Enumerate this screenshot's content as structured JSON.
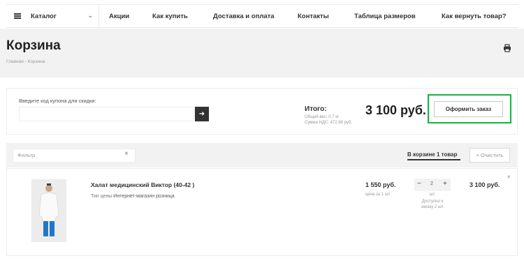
{
  "nav": {
    "catalog_label": "Каталог",
    "items": [
      "Акции",
      "Как купить",
      "Доставка и оплата",
      "Контакты",
      "Таблица размеров",
      "Как вернуть товар?"
    ]
  },
  "header": {
    "title": "Корзина",
    "breadcrumb": "Главная - Корзина"
  },
  "summary": {
    "coupon_label": "Введите код купона для скидки:",
    "coupon_value": "",
    "total_label": "Итого:",
    "weight": "Общий вес: 0.7 кг",
    "vat": "Сумма НДС: 472.88 руб.",
    "total_price": "3 100 руб.",
    "checkout_label": "Оформить заказ"
  },
  "filter": {
    "placeholder": "Фильтр",
    "basket_tab": "В корзине 1 товар",
    "clear_label": "Очистить"
  },
  "item": {
    "name": "Халат медицинский Виктор (40-42 )",
    "price_type_label": "Тип цены",
    "price_type_value": "Интернет-магазин розница",
    "unit_price": "1 550 руб.",
    "unit_note": "цена за 1 шт.",
    "quantity": "2",
    "qty_unit": "шт.",
    "availability_line1": "Доступно к",
    "availability_line2": "заказу 2 шт.",
    "total": "3 100 руб."
  },
  "colors": {
    "highlight": "#27a84a",
    "dark_button": "#333333",
    "band": "#f2f2f2"
  },
  "icons": [
    "menu-icon",
    "chevron-down-icon",
    "printer-icon",
    "arrow-right-icon",
    "close-icon"
  ]
}
